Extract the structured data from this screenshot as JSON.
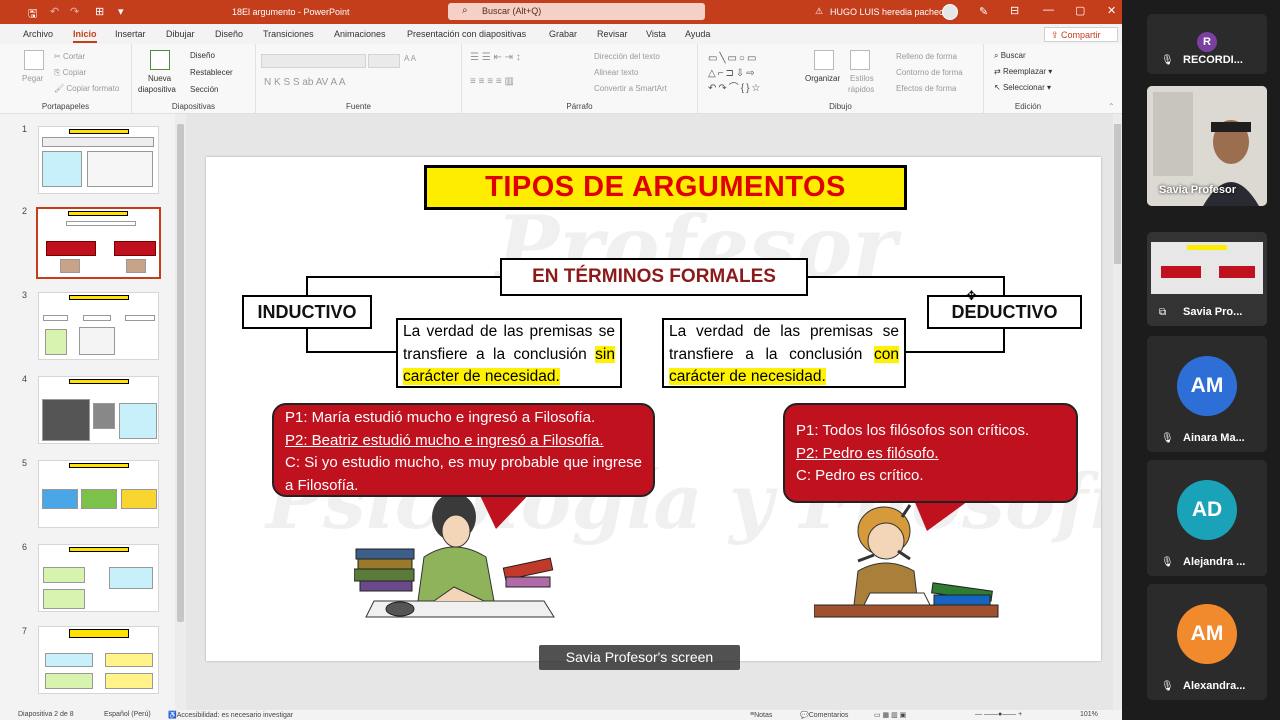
{
  "titlebar": {
    "doc_title": "18El argumento  -  PowerPoint",
    "search_placeholder": "Buscar (Alt+Q)",
    "warning": "⚠",
    "user_name": "HUGO LUIS heredia pacheco",
    "minimize": "—",
    "restore": "▢",
    "close": "✕",
    "ribbon_display": "⊟"
  },
  "tabs": [
    "Archivo",
    "Inicio",
    "Insertar",
    "Dibujar",
    "Diseño",
    "Transiciones",
    "Animaciones",
    "Presentación con diapositivas",
    "Grabar",
    "Revisar",
    "Vista",
    "Ayuda"
  ],
  "share_label": "Compartir",
  "ribbon": {
    "portapapeles": {
      "label": "Portapapeles",
      "pegar": "Pegar",
      "cortar": "Cortar",
      "copiar": "Copiar",
      "copiar_formato": "Copiar formato"
    },
    "diapositivas": {
      "label": "Diapositivas",
      "nueva": "Nueva",
      "diapositiva": "diapositiva",
      "diseno": "Diseño",
      "restablecer": "Restablecer",
      "seccion": "Sección"
    },
    "fuente": {
      "label": "Fuente",
      "format_icons": "N  K  S  S  ab  AV    A    A"
    },
    "parrafo": {
      "label": "Párrafo",
      "direccion": "Dirección del texto",
      "alinear": "Alinear texto",
      "smartart": "Convertir a SmartArt"
    },
    "dibujo": {
      "label": "Dibujo",
      "organizar": "Organizar",
      "estilos": "Estilos",
      "rapidos": "rápidos",
      "relleno": "Relleno de forma",
      "contorno": "Contorno de forma",
      "efectos": "Efectos de forma"
    },
    "edicion": {
      "label": "Edición",
      "buscar": "Buscar",
      "reemplazar": "Reemplazar",
      "seleccionar": "Seleccionar"
    }
  },
  "thumbnails": [
    {
      "num": "1"
    },
    {
      "num": "2"
    },
    {
      "num": "3"
    },
    {
      "num": "4"
    },
    {
      "num": "5"
    },
    {
      "num": "6"
    },
    {
      "num": "7"
    }
  ],
  "thumb_titles": [
    "EL ARGUMENTO",
    "TIPOS DE ARGUMENTOS",
    "EN TÉRMINOS FORMALES",
    "TEORÍA DE LA ARGUMENTACIÓN",
    "ESTUDIOS DEL RAZONAMIENTO",
    "ANÁLISIS DE LOS ARGUMENTOS",
    "DEFENSA DE UNA TESIS MEDIANTE UNA JUSTIFICACIÓN RACIONAL"
  ],
  "slide": {
    "title": "TIPOS DE ARGUMENTOS",
    "subtitle": "EN TÉRMINOS FORMALES",
    "watermark_1": "Profesor",
    "watermark_2": "Psicología y Filosofía",
    "inductive": {
      "label": "INDUCTIVO",
      "def_plain": "La verdad de las premisas se transfiere a la conclusión ",
      "def_highlight": "sin carácter de necesidad.",
      "p1": "P1: María estudió mucho e ingresó a Filosofía.",
      "p2": "P2: Beatriz estudió mucho e ingresó a Filosofía.",
      "c": "C: Si yo estudio mucho, es muy probable que ingrese a Filosofía."
    },
    "deductive": {
      "label": "DEDUCTIVO",
      "def_plain": "La verdad de las premisas se transfiere a la conclusión ",
      "def_highlight": "con carácter de necesidad.",
      "p1": "P1: Todos los filósofos son críticos.",
      "p2": "P2: Pedro es filósofo.",
      "c": "C: Pedro es crítico."
    }
  },
  "screen_label": "Savia Profesor's screen",
  "statusbar": {
    "slide_count": "Diapositiva 2 de 8",
    "language": "Español (Perú)",
    "accessibility": "Accesibilidad: es necesario investigar",
    "notes": "Notas",
    "comments": "Comentarios",
    "zoom": "101%"
  },
  "participants": [
    {
      "initials": "R",
      "name": "RECORDI...",
      "color": "#7b3fa0"
    },
    {
      "name": "Savia Profesor",
      "type": "video"
    },
    {
      "name": "Savia Pro...",
      "type": "screen"
    },
    {
      "initials": "AM",
      "name": "Ainara Ma...",
      "color": "#2d6fd6"
    },
    {
      "initials": "AD",
      "name": "Alejandra ...",
      "color": "#1aa3b8"
    },
    {
      "initials": "AM",
      "name": "Alexandra...",
      "color": "#f08a2c"
    }
  ],
  "colors": {
    "accent": "#c43e1c",
    "slide_title_bg": "#ffed00",
    "slide_title_text": "#e10000",
    "bubble": "#c0111f",
    "highlight": "#fff200"
  }
}
